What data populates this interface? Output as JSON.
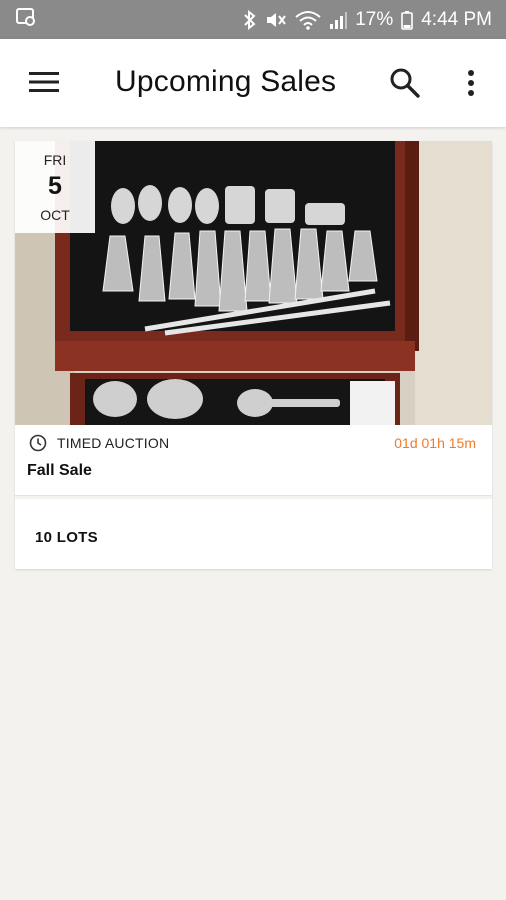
{
  "status_bar": {
    "battery": "17%",
    "time": "4:44 PM",
    "icons": [
      "cast-icon",
      "bluetooth-icon",
      "mute-icon",
      "wifi-icon",
      "signal-icon",
      "battery-icon"
    ]
  },
  "app_bar": {
    "title": "Upcoming Sales",
    "icons": [
      "menu-icon",
      "search-icon",
      "more-vert-icon"
    ]
  },
  "sale": {
    "date_day": "FRI",
    "date_number": "5",
    "date_month": "OCT",
    "type": "TIMED AUCTION",
    "countdown": "01d 01h 15m",
    "name": "Fall Sale",
    "lots": "10 LOTS",
    "image_description_icon": "silverware-photo"
  },
  "colors": {
    "status_bar": "#8a8a8a",
    "background": "#f3f2ef",
    "accent": "#f07a2a"
  }
}
